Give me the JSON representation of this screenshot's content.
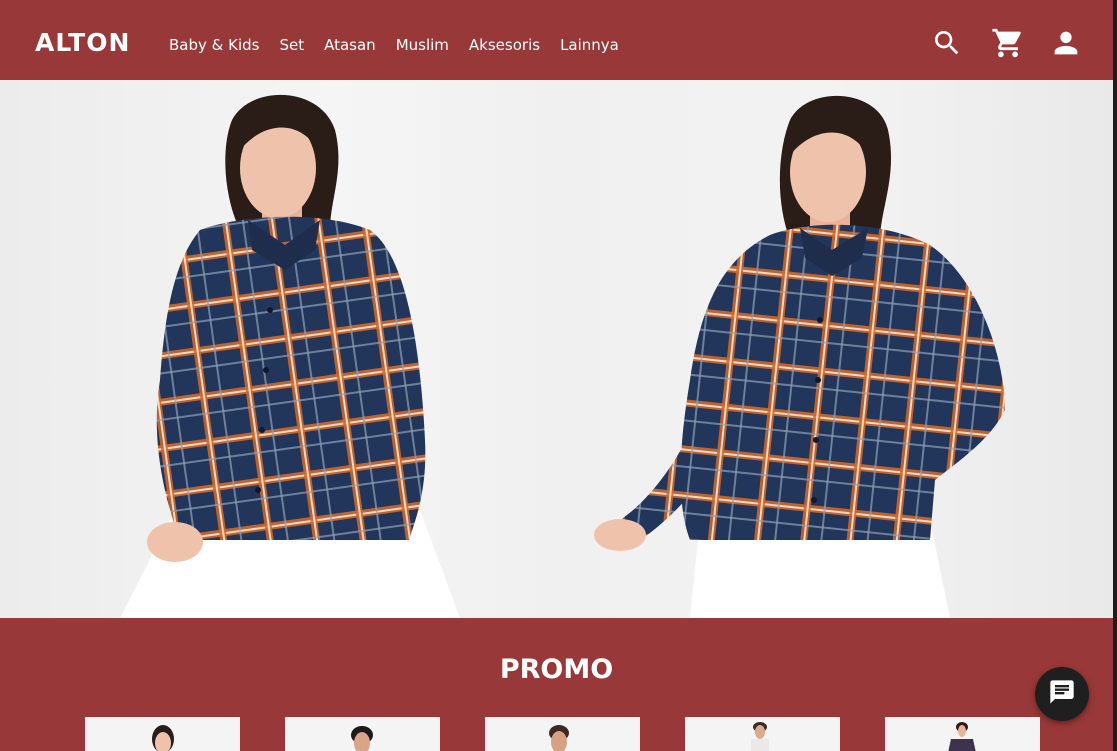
{
  "brand": {
    "logo_text": "ALTON"
  },
  "nav": {
    "items": [
      {
        "label": "Baby & Kids"
      },
      {
        "label": "Set"
      },
      {
        "label": "Atasan"
      },
      {
        "label": "Muslim"
      },
      {
        "label": "Aksesoris"
      },
      {
        "label": "Lainnya"
      }
    ]
  },
  "header_icons": [
    "search-icon",
    "cart-icon",
    "account-icon"
  ],
  "hero": {
    "subject": "models-in-plaid-flannel-shirts"
  },
  "promo": {
    "title": "PROMO",
    "card_count": 5
  },
  "chat": {
    "icon": "chat-icon"
  },
  "colors": {
    "brand": "#983838",
    "text_on_brand": "#ffffff",
    "chat_button": "#1f1f1f",
    "shirt_navy": "#22355a",
    "shirt_orange": "#d2692a"
  }
}
